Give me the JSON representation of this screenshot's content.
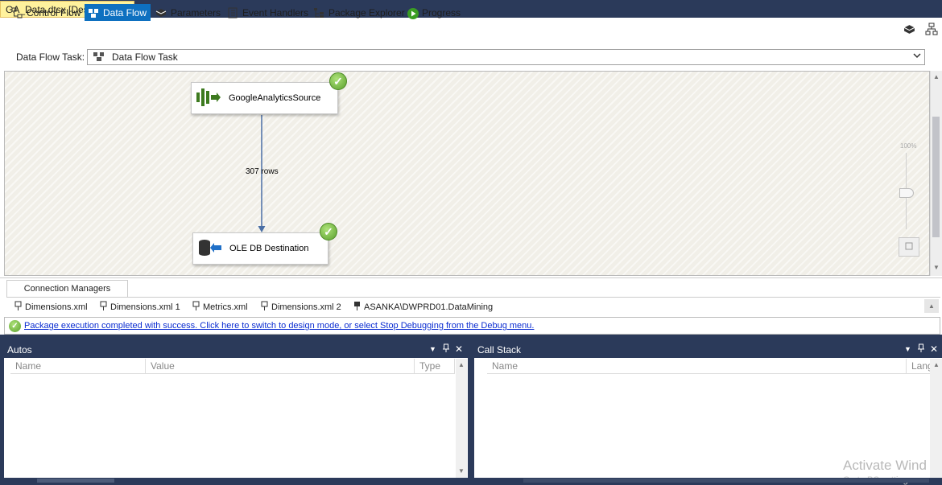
{
  "document_tab": {
    "title": "GA_Data.dtsx [Design]",
    "pin": "⊓",
    "close": "✕"
  },
  "toolbar": {
    "buttons": [
      {
        "label": "Control Flow",
        "icon": "control-flow-icon"
      },
      {
        "label": "Data Flow",
        "icon": "data-flow-icon",
        "active": true
      },
      {
        "label": "Parameters",
        "icon": "parameters-icon"
      },
      {
        "label": "Event Handlers",
        "icon": "event-handlers-icon"
      },
      {
        "label": "Package Explorer",
        "icon": "package-explorer-icon"
      },
      {
        "label": "Progress",
        "icon": "progress-icon"
      }
    ]
  },
  "data_flow_task": {
    "label": "Data Flow Task:",
    "value": "Data Flow Task"
  },
  "canvas": {
    "source_node": "GoogleAnalyticsSource",
    "destination_node": "OLE DB Destination",
    "path_label": "307 rows",
    "zoom": "100%"
  },
  "connection_managers": {
    "tab_label": "Connection Managers",
    "items": [
      "Dimensions.xml",
      "Dimensions.xml 1",
      "Metrics.xml",
      "Dimensions.xml 2",
      "ASANKA\\DWPRD01.DataMining"
    ]
  },
  "status": {
    "message": "Package execution completed with success. Click here to switch to design mode, or select Stop Debugging from the Debug menu."
  },
  "autos_pane": {
    "title": "Autos",
    "columns": [
      "Name",
      "Value",
      "Type"
    ]
  },
  "callstack_pane": {
    "title": "Call Stack",
    "columns": [
      "Name",
      "Lang"
    ]
  },
  "watermark": {
    "line1": "Activate Wind",
    "line2": "Go to PC settings"
  },
  "colors": {
    "chrome": "#2b3a5a",
    "tab_active": "#fff29d",
    "accent": "#0e70c0",
    "success": "#5aa02c",
    "link": "#0a2cd1"
  }
}
